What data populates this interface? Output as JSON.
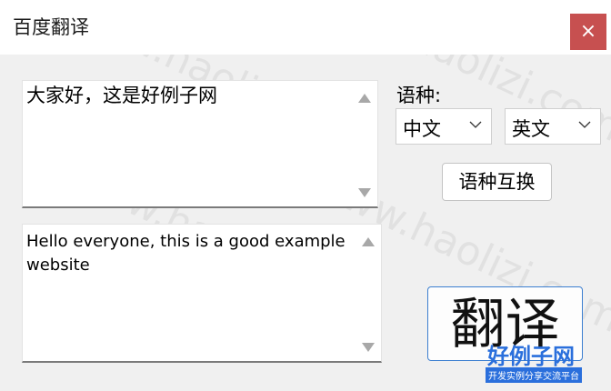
{
  "window": {
    "title": "百度翻译",
    "close_icon": "×"
  },
  "input": {
    "text": "大家好，这是好例子网"
  },
  "output": {
    "text": "Hello everyone, this is a good example website"
  },
  "language": {
    "label": "语种:",
    "source": "中文",
    "target": "英文"
  },
  "buttons": {
    "swap": "语种互换",
    "translate": "翻译"
  },
  "watermark": {
    "text": "www.haolizi.com"
  },
  "logo": {
    "main": "好例子网",
    "sub": "开发实例分享交流平台"
  },
  "colors": {
    "close": "#c75050",
    "accent": "#3c7fd0",
    "logo": "#2a6fdc"
  }
}
